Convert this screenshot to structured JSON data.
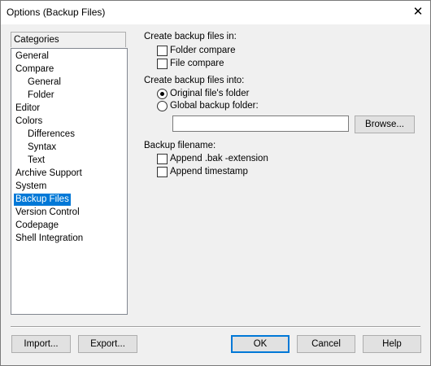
{
  "window": {
    "title": "Options (Backup Files)",
    "close_glyph": "✕"
  },
  "categories": {
    "header": "Categories",
    "items": [
      {
        "label": "General",
        "level": 0
      },
      {
        "label": "Compare",
        "level": 0
      },
      {
        "label": "General",
        "level": 1
      },
      {
        "label": "Folder",
        "level": 1
      },
      {
        "label": "Editor",
        "level": 0
      },
      {
        "label": "Colors",
        "level": 0
      },
      {
        "label": "Differences",
        "level": 1
      },
      {
        "label": "Syntax",
        "level": 1
      },
      {
        "label": "Text",
        "level": 1
      },
      {
        "label": "Archive Support",
        "level": 0
      },
      {
        "label": "System",
        "level": 0
      },
      {
        "label": "Backup Files",
        "level": 0,
        "selected": true
      },
      {
        "label": "Version Control",
        "level": 0
      },
      {
        "label": "Codepage",
        "level": 0
      },
      {
        "label": "Shell Integration",
        "level": 0
      }
    ]
  },
  "create_in": {
    "heading": "Create backup files in:",
    "folder_compare": {
      "label": "Folder compare",
      "checked": false
    },
    "file_compare": {
      "label": "File compare",
      "checked": false
    }
  },
  "create_into": {
    "heading": "Create backup files into:",
    "original_folder": {
      "label": "Original file's folder",
      "selected": true
    },
    "global_folder": {
      "label": "Global backup folder:",
      "selected": false
    },
    "folder_path": "",
    "browse_label": "Browse..."
  },
  "filename": {
    "heading": "Backup filename:",
    "append_bak": {
      "label": "Append .bak -extension",
      "checked": false
    },
    "append_timestamp": {
      "label": "Append timestamp",
      "checked": false
    }
  },
  "footer": {
    "import_label": "Import...",
    "export_label": "Export...",
    "ok_label": "OK",
    "cancel_label": "Cancel",
    "help_label": "Help"
  }
}
